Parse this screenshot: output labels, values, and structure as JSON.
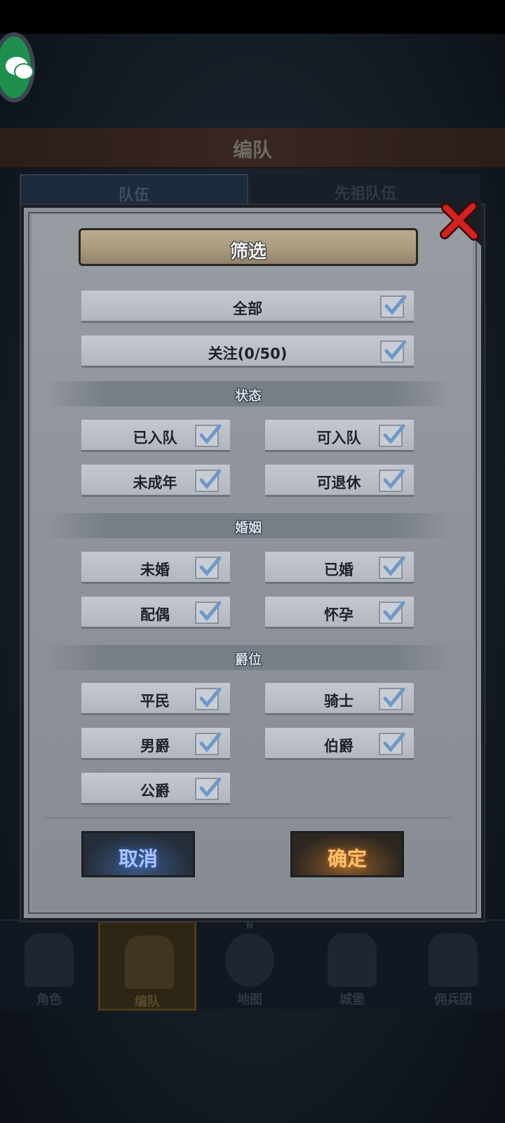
{
  "background": {
    "title": "编队",
    "tabs": [
      {
        "label": "队伍"
      },
      {
        "label": "先祖队伍"
      }
    ],
    "nav": [
      {
        "label": "角色",
        "icon": "knight-icon"
      },
      {
        "label": "编队",
        "icon": "helmet-icon"
      },
      {
        "label": "地图",
        "icon": "compass-map-icon"
      },
      {
        "label": "城堡",
        "icon": "castle-icon"
      },
      {
        "label": "佣兵团",
        "icon": "mercenary-icon"
      }
    ],
    "compass_n": "N"
  },
  "dialog": {
    "title": "筛选",
    "all_label": "全部",
    "follow_label": "关注(0/50)",
    "sections": {
      "status": {
        "title": "状态",
        "options": [
          {
            "label": "已入队",
            "checked": true
          },
          {
            "label": "可入队",
            "checked": true
          },
          {
            "label": "未成年",
            "checked": true
          },
          {
            "label": "可退休",
            "checked": true
          }
        ]
      },
      "marriage": {
        "title": "婚姻",
        "options": [
          {
            "label": "未婚",
            "checked": true
          },
          {
            "label": "已婚",
            "checked": true
          },
          {
            "label": "配偶",
            "checked": true
          },
          {
            "label": "怀孕",
            "checked": true
          }
        ]
      },
      "rank": {
        "title": "爵位",
        "options": [
          {
            "label": "平民",
            "checked": true
          },
          {
            "label": "骑士",
            "checked": true
          },
          {
            "label": "男爵",
            "checked": true
          },
          {
            "label": "伯爵",
            "checked": true
          },
          {
            "label": "公爵",
            "checked": true
          }
        ]
      }
    },
    "cancel_label": "取消",
    "confirm_label": "确定"
  },
  "colors": {
    "cancel_text": "#a9c4ff",
    "confirm_text": "#ffc070",
    "close_x": "#d42020"
  }
}
